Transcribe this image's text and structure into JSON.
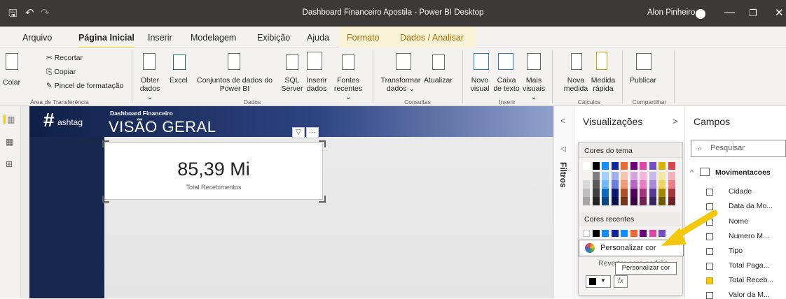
{
  "window": {
    "title": "Dashboard Financeiro Apostila - Power BI Desktop",
    "user": "Alon Pinheiro",
    "controls": [
      "—",
      "❐",
      "✕"
    ]
  },
  "tabs": [
    {
      "label": "Arquivo"
    },
    {
      "label": "Página Inicial"
    },
    {
      "label": "Inserir"
    },
    {
      "label": "Modelagem"
    },
    {
      "label": "Exibição"
    },
    {
      "label": "Ajuda"
    },
    {
      "label": "Formato"
    },
    {
      "label": "Dados / Analisar"
    }
  ],
  "ribbon": {
    "paste": "Colar",
    "cut": "Recortar",
    "copy": "Copiar",
    "format_painter": "Pincel de formatação",
    "get_data": "Obter dados ⌄",
    "excel": "Excel",
    "datasets": "Conjuntos de dados do Power BI",
    "sql": "SQL Server",
    "enter_data": "Inserir dados",
    "recent_sources": "Fontes recentes ⌄",
    "transform": "Transformar dados ⌄",
    "refresh": "Atualizar",
    "new_visual": "Novo visual",
    "text_box": "Caixa de texto",
    "more_visuals": "Mais visuais ⌄",
    "new_measure": "Nova medida",
    "quick_measure": "Medida rápida",
    "publish": "Publicar",
    "groups": {
      "clipboard": "Área de Transferência",
      "data": "Dados",
      "queries": "Consultas",
      "insert": "Inserir",
      "calculations": "Cálculos",
      "share": "Compartilhar"
    }
  },
  "report": {
    "logo": "ashtag",
    "subtitle": "Dashboard Financeiro",
    "title": "VISÃO GERAL"
  },
  "card": {
    "value": "85,39 Mi",
    "label": "Total Recebimentos"
  },
  "filters_label": "Filtros",
  "visualizations": {
    "title": "Visualizações",
    "theme_colors": "Cores do tema",
    "recent_colors": "Cores recentes",
    "custom_color": "Personalizar cor",
    "revert": "Reverter para padrão",
    "tooltip": "Personalizar cor"
  },
  "fields": {
    "title": "Campos",
    "search_placeholder": "Pesquisar",
    "table": "Movimentacoes",
    "items": [
      {
        "label": "Cidade",
        "checked": false
      },
      {
        "label": "Data da Mo...",
        "checked": false
      },
      {
        "label": "Nome",
        "checked": false
      },
      {
        "label": "Numero M...",
        "checked": false
      },
      {
        "label": "Tipo",
        "checked": false
      },
      {
        "label": "Total Paga...",
        "checked": false
      },
      {
        "label": "Total Receb...",
        "checked": true
      },
      {
        "label": "Valor da M...",
        "checked": false
      }
    ]
  },
  "colors": {
    "accent": "#f2c811",
    "title_bar": "#3b3a39",
    "navy": "#16284e"
  }
}
